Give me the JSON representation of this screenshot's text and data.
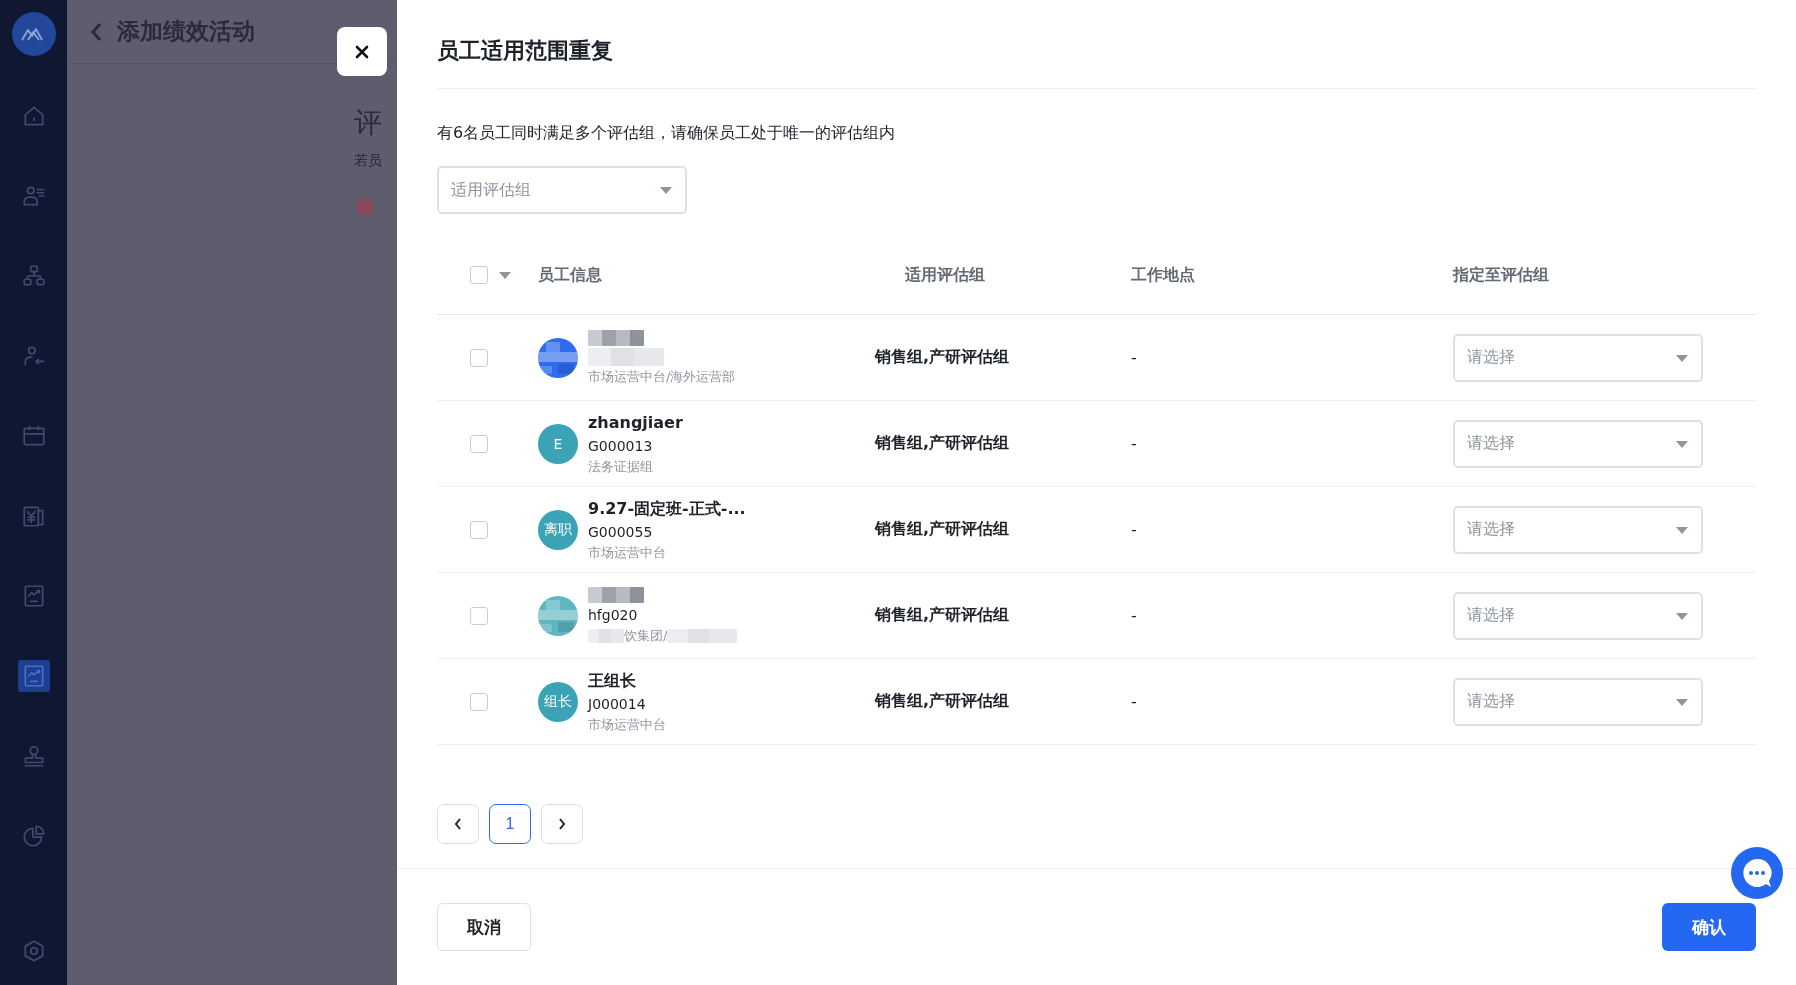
{
  "sidebar": {
    "items": [
      {
        "selected": false
      },
      {
        "selected": false
      },
      {
        "selected": false
      },
      {
        "selected": false
      },
      {
        "selected": false
      },
      {
        "selected": false
      },
      {
        "selected": false
      },
      {
        "selected": true
      },
      {
        "selected": false
      },
      {
        "selected": false
      }
    ]
  },
  "background_page": {
    "title": "添加绩效活动",
    "section_title": "评",
    "hint": "若员"
  },
  "dialog": {
    "title": "员工适用范围重复",
    "message": "有6名员工同时满足多个评估组，请确保员工处于唯一的评估组内",
    "filter": {
      "placeholder": "适用评估组"
    },
    "table": {
      "columns": [
        "员工信息",
        "适用评估组",
        "工作地点",
        "指定至评估组"
      ],
      "header_checked": false,
      "rows": [
        {
          "checked": false,
          "dept": "市场运营中台/海外运营部",
          "groups": "销售组,产研评估组",
          "location": "-",
          "assign": {
            "placeholder": "请选择"
          }
        },
        {
          "checked": false,
          "avatar": {
            "kind": "text",
            "text": "E",
            "color": "#3aa3b5"
          },
          "name": "zhangjiaer",
          "id": "G000013",
          "dept": "法务证据组",
          "groups": "销售组,产研评估组",
          "location": "-",
          "assign": {
            "placeholder": "请选择"
          }
        },
        {
          "checked": false,
          "avatar": {
            "kind": "text",
            "text": "离职",
            "color": "#3aa3b5"
          },
          "name": "9.27-固定班-正式-...",
          "id": "G000055",
          "dept": "市场运营中台",
          "groups": "销售组,产研评估组",
          "location": "-",
          "assign": {
            "placeholder": "请选择"
          }
        },
        {
          "checked": false,
          "id": "hfg020",
          "dept_part": "饮集团/",
          "groups": "销售组,产研评估组",
          "location": "-",
          "assign": {
            "placeholder": "请选择"
          }
        },
        {
          "checked": false,
          "avatar": {
            "kind": "text",
            "text": "组长",
            "color": "#3aa3b5"
          },
          "name": "王组长",
          "id": "J000014",
          "dept": "市场运营中台",
          "groups": "销售组,产研评估组",
          "location": "-",
          "assign": {
            "placeholder": "请选择"
          }
        }
      ]
    },
    "pagination": {
      "pages": [
        {
          "label": "1",
          "selected": true
        }
      ]
    },
    "cancel": "取消",
    "confirm": "确认"
  }
}
